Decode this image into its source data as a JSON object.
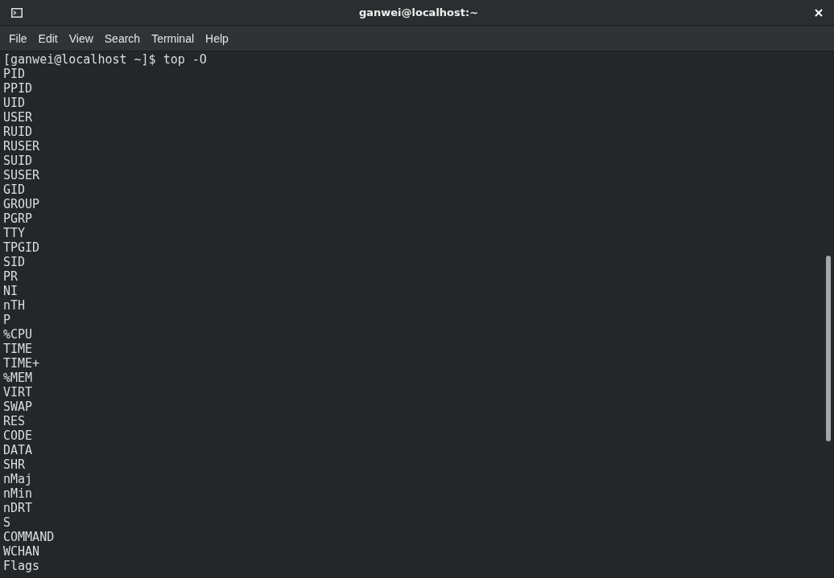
{
  "window": {
    "title": "ganwei@localhost:~"
  },
  "menu": [
    "File",
    "Edit",
    "View",
    "Search",
    "Terminal",
    "Help"
  ],
  "terminal": {
    "lines": [
      "[ganwei@localhost ~]$ top -O",
      "PID",
      "PPID",
      "UID",
      "USER",
      "RUID",
      "RUSER",
      "SUID",
      "SUSER",
      "GID",
      "GROUP",
      "PGRP",
      "TTY",
      "TPGID",
      "SID",
      "PR",
      "NI",
      "nTH",
      "P",
      "%CPU",
      "TIME",
      "TIME+",
      "%MEM",
      "VIRT",
      "SWAP",
      "RES",
      "CODE",
      "DATA",
      "SHR",
      "nMaj",
      "nMin",
      "nDRT",
      "S",
      "COMMAND",
      "WCHAN",
      "Flags"
    ]
  }
}
